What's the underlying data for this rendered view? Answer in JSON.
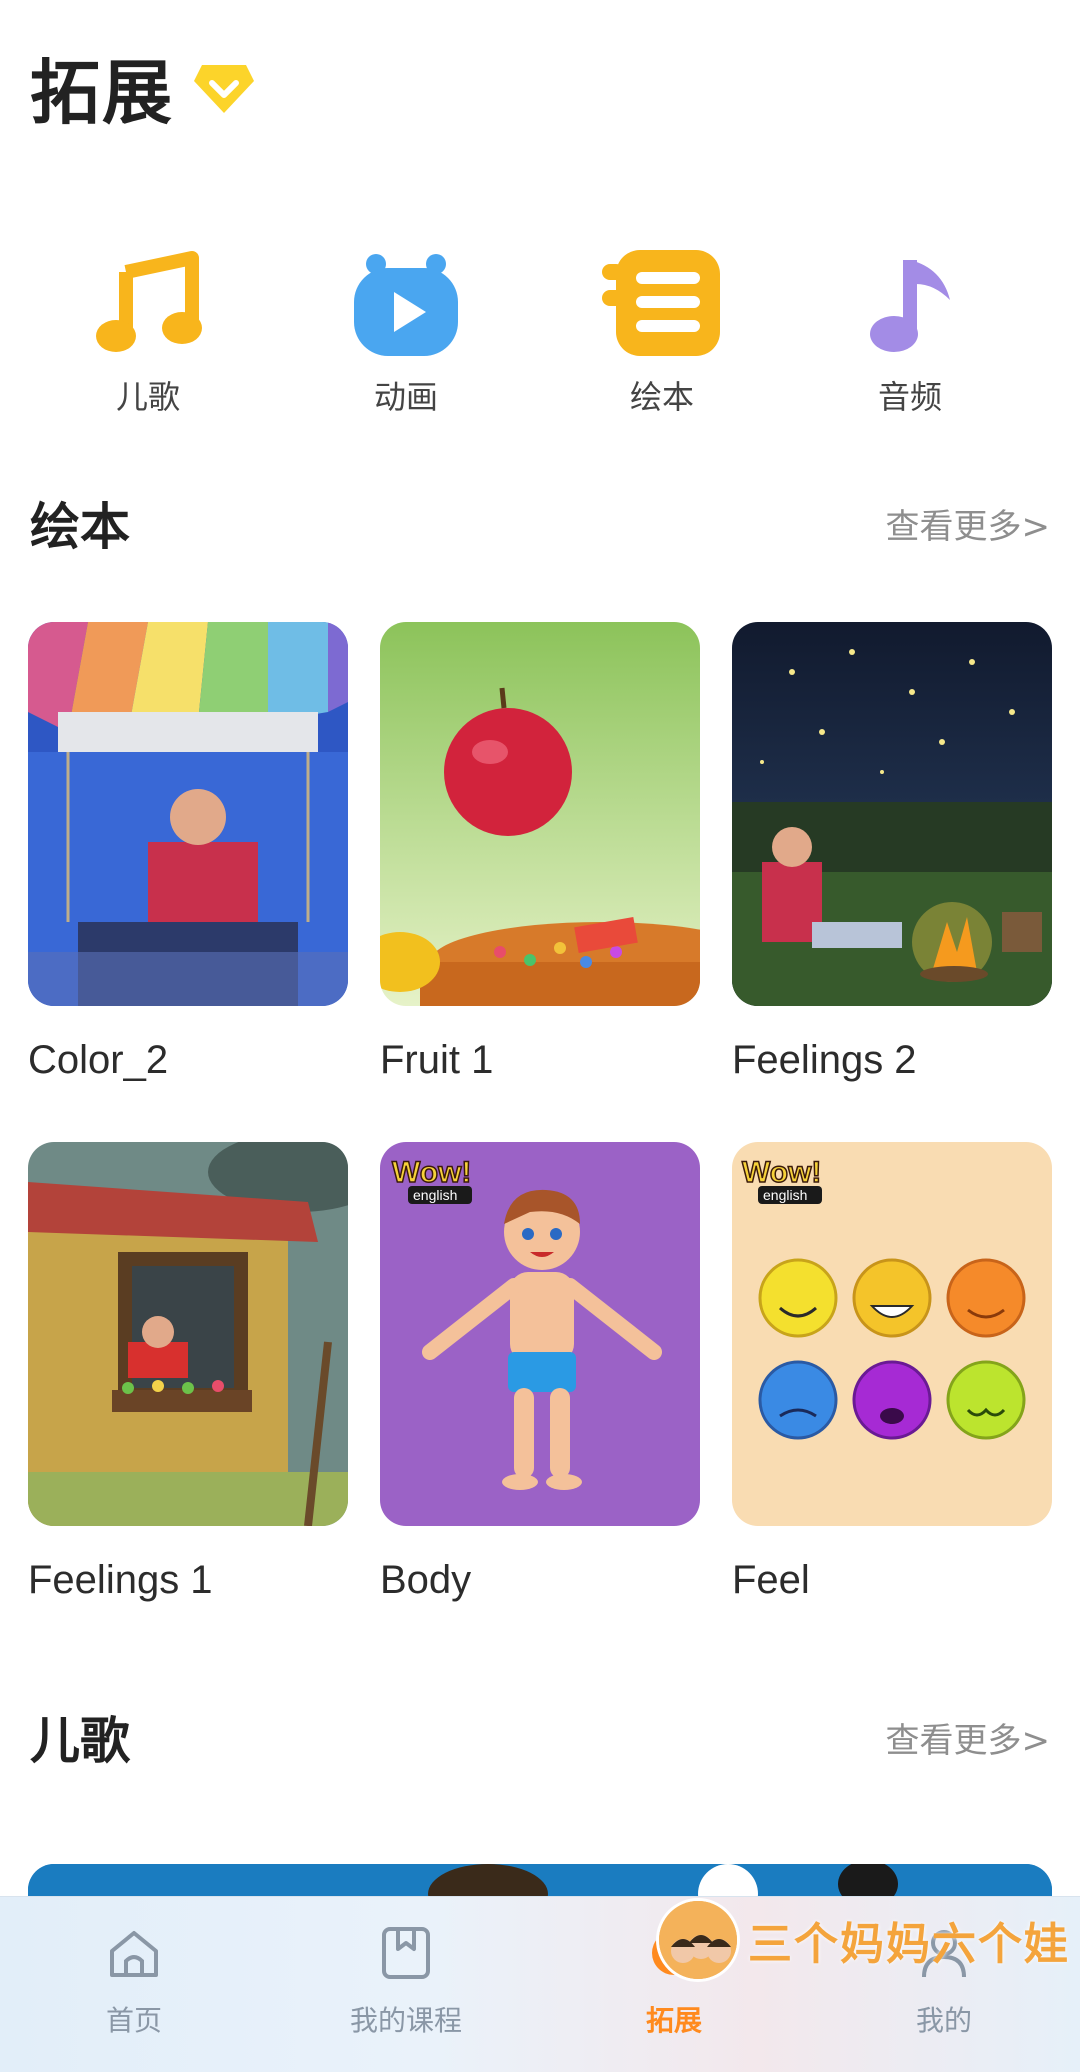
{
  "header": {
    "title": "拓展"
  },
  "categories": [
    {
      "label": "儿歌",
      "icon": "music-note-icon",
      "color": "#f8b51c"
    },
    {
      "label": "动画",
      "icon": "tv-play-icon",
      "color": "#4aa6f0"
    },
    {
      "label": "绘本",
      "icon": "book-stack-icon",
      "color": "#f8b51c"
    },
    {
      "label": "音频",
      "icon": "audio-note-icon",
      "color": "#a38ce6"
    }
  ],
  "picture_books": {
    "title": "绘本",
    "more": "查看更多>",
    "items": [
      {
        "name": "Color_2"
      },
      {
        "name": "Fruit 1"
      },
      {
        "name": "Feelings 2"
      },
      {
        "name": "Feelings 1"
      },
      {
        "name": "Body",
        "badge_top": "Wow!",
        "badge_bottom": "english"
      },
      {
        "name": "Feel",
        "badge_top": "Wow!",
        "badge_bottom": "english"
      }
    ]
  },
  "songs": {
    "title": "儿歌",
    "more": "查看更多>"
  },
  "tabbar": {
    "items": [
      {
        "label": "首页",
        "icon": "home-icon"
      },
      {
        "label": "我的课程",
        "icon": "bookmark-book-icon"
      },
      {
        "label": "拓展",
        "icon": "explore-icon",
        "active": true
      },
      {
        "label": "我的",
        "icon": "profile-icon"
      }
    ],
    "active_color": "#ff8a1e",
    "inactive_color": "#8a97a6"
  },
  "watermark": {
    "text": "三个妈妈六个娃"
  }
}
